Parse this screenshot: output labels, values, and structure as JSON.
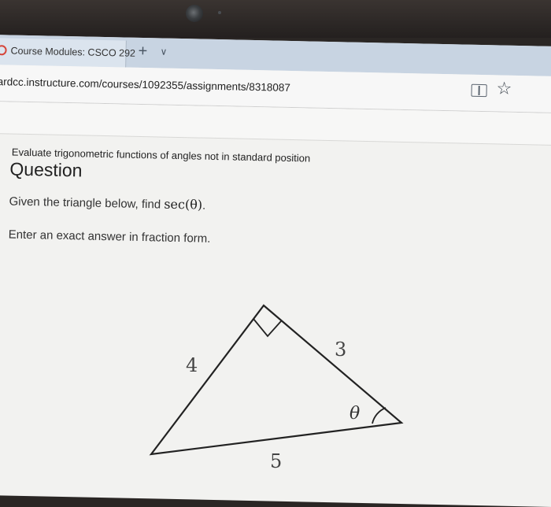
{
  "browser": {
    "tab_title": "Course Modules: CSCO 292",
    "new_tab_symbol": "+",
    "tab_menu_symbol": "∨",
    "url": "ardcc.instructure.com/courses/1092355/assignments/8318087",
    "icons": [
      "reading-view-icon",
      "favorite-star-icon"
    ]
  },
  "question": {
    "topic": "Evaluate trigonometric functions of angles not in standard position",
    "heading": "Question",
    "prompt_text": "Given the triangle below, find",
    "prompt_math": "sec(θ)",
    "prompt_end": ".",
    "instruction": "Enter an exact answer in fraction form."
  },
  "triangle": {
    "side_left": "4",
    "side_right": "3",
    "side_bottom": "5",
    "angle_label": "θ"
  }
}
